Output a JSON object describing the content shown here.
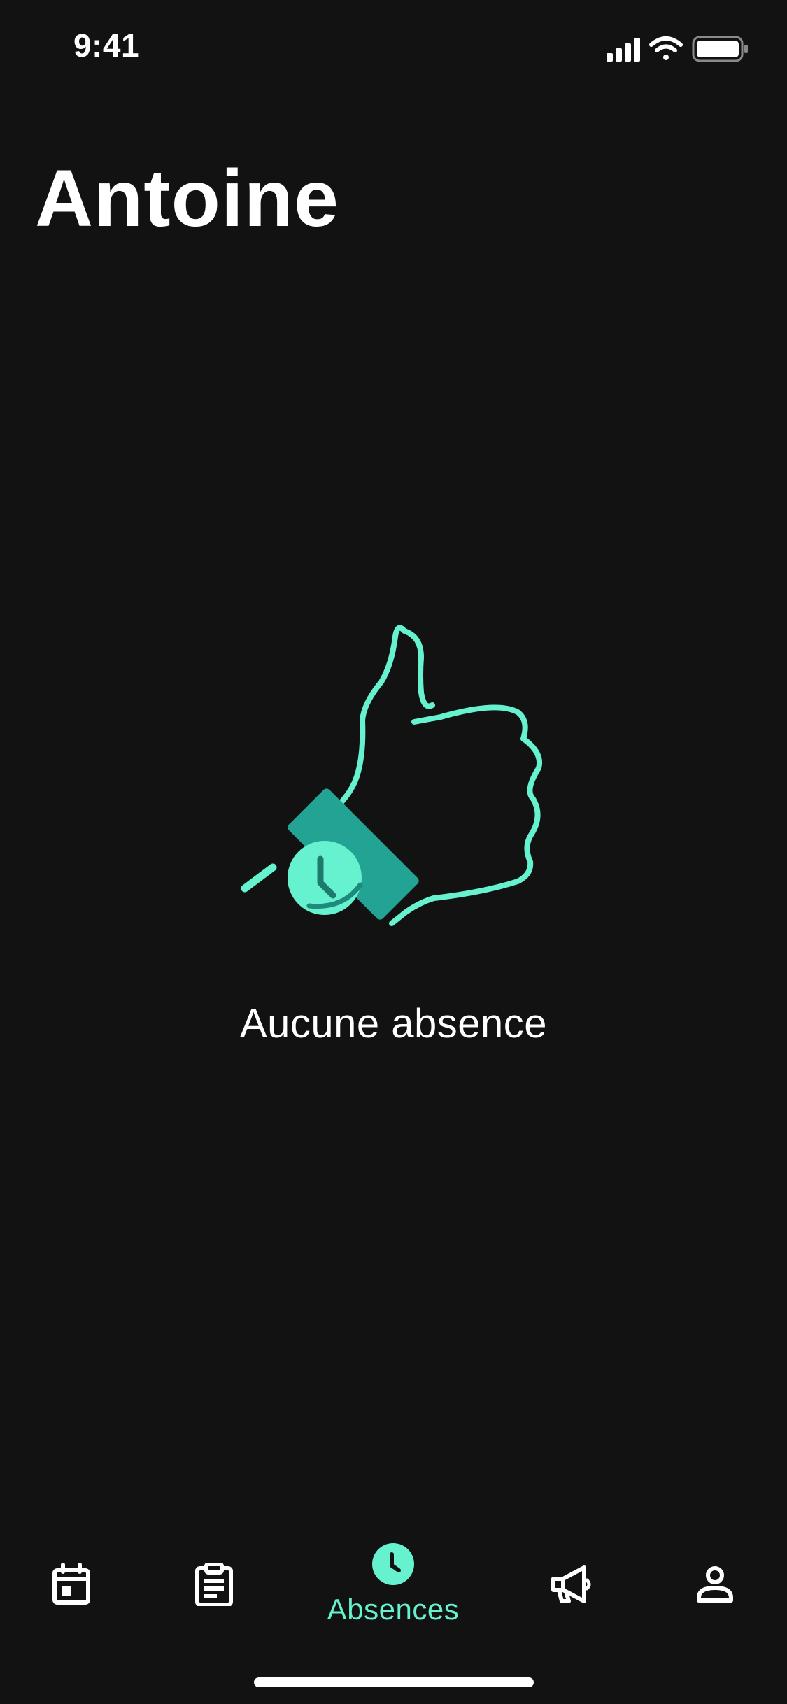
{
  "status_bar": {
    "time": "9:41"
  },
  "header": {
    "title": "Antoine"
  },
  "empty_state": {
    "message": "Aucune absence",
    "illustration": "thumbs-up-watch-illustration"
  },
  "tab_bar": {
    "active_index": 2,
    "items": [
      {
        "icon": "calendar-icon",
        "label": ""
      },
      {
        "icon": "clipboard-icon",
        "label": ""
      },
      {
        "icon": "clock-icon",
        "label": "Absences"
      },
      {
        "icon": "megaphone-icon",
        "label": ""
      },
      {
        "icon": "profile-icon",
        "label": ""
      }
    ]
  },
  "colors": {
    "background": "#121212",
    "accent": "#66f2cf",
    "accent_dark": "#23a393",
    "text": "#ffffff"
  }
}
